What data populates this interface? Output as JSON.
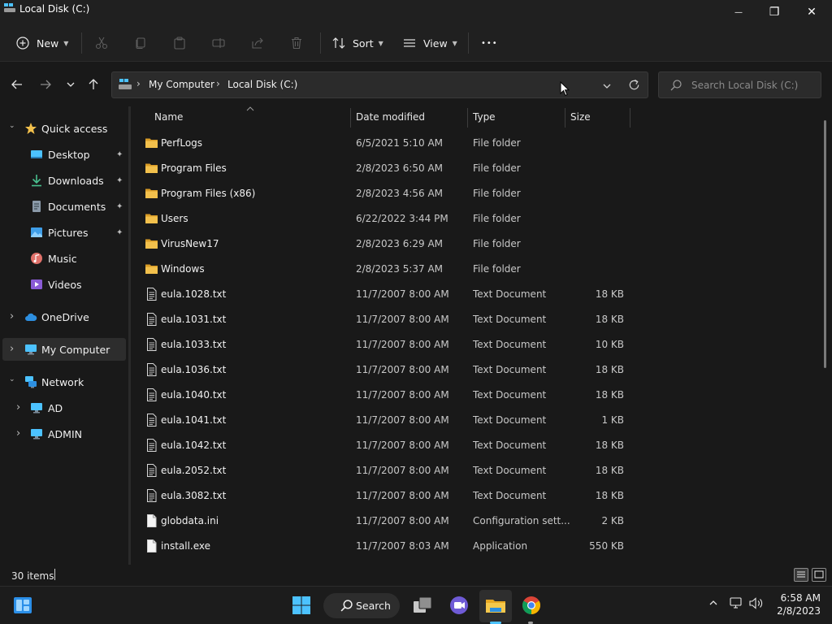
{
  "window": {
    "title": "Local Disk (C:)",
    "minimize_glyph": "—",
    "restore_glyph": "❐",
    "close_glyph": "✕"
  },
  "toolbar": {
    "new_label": "New",
    "sort_label": "Sort",
    "view_label": "View",
    "more_glyph": "•••"
  },
  "address": {
    "segments": [
      "My Computer",
      "Local Disk (C:)"
    ],
    "separator": "›",
    "search_placeholder": "Search Local Disk (C:)"
  },
  "sidebar": {
    "items": [
      {
        "label": "Quick access",
        "icon": "star-icon"
      },
      {
        "label": "Desktop",
        "icon": "desktop-icon"
      },
      {
        "label": "Downloads",
        "icon": "download-icon"
      },
      {
        "label": "Documents",
        "icon": "document-icon"
      },
      {
        "label": "Pictures",
        "icon": "picture-icon"
      },
      {
        "label": "Music",
        "icon": "music-icon"
      },
      {
        "label": "Videos",
        "icon": "video-icon"
      },
      {
        "label": "OneDrive",
        "icon": "cloud-icon"
      },
      {
        "label": "My Computer",
        "icon": "computer-icon"
      },
      {
        "label": "Network",
        "icon": "network-icon"
      },
      {
        "label": "AD",
        "icon": "computer-icon"
      },
      {
        "label": "ADMIN",
        "icon": "computer-icon"
      }
    ],
    "pin_glyph": "📌",
    "chevron_right": "›",
    "chevron_down": "⌄"
  },
  "columns": {
    "name": "Name",
    "date": "Date modified",
    "type": "Type",
    "size": "Size"
  },
  "files": [
    {
      "name": "PerfLogs",
      "date": "6/5/2021 5:10 AM",
      "type": "File folder",
      "size": "",
      "kind": "folder"
    },
    {
      "name": "Program Files",
      "date": "2/8/2023 6:50 AM",
      "type": "File folder",
      "size": "",
      "kind": "folder"
    },
    {
      "name": "Program Files (x86)",
      "date": "2/8/2023 4:56 AM",
      "type": "File folder",
      "size": "",
      "kind": "folder"
    },
    {
      "name": "Users",
      "date": "6/22/2022 3:44 PM",
      "type": "File folder",
      "size": "",
      "kind": "folder"
    },
    {
      "name": "VirusNew17",
      "date": "2/8/2023 6:29 AM",
      "type": "File folder",
      "size": "",
      "kind": "folder"
    },
    {
      "name": "Windows",
      "date": "2/8/2023 5:37 AM",
      "type": "File folder",
      "size": "",
      "kind": "folder"
    },
    {
      "name": "eula.1028.txt",
      "date": "11/7/2007 8:00 AM",
      "type": "Text Document",
      "size": "18 KB",
      "kind": "text"
    },
    {
      "name": "eula.1031.txt",
      "date": "11/7/2007 8:00 AM",
      "type": "Text Document",
      "size": "18 KB",
      "kind": "text"
    },
    {
      "name": "eula.1033.txt",
      "date": "11/7/2007 8:00 AM",
      "type": "Text Document",
      "size": "10 KB",
      "kind": "text"
    },
    {
      "name": "eula.1036.txt",
      "date": "11/7/2007 8:00 AM",
      "type": "Text Document",
      "size": "18 KB",
      "kind": "text"
    },
    {
      "name": "eula.1040.txt",
      "date": "11/7/2007 8:00 AM",
      "type": "Text Document",
      "size": "18 KB",
      "kind": "text"
    },
    {
      "name": "eula.1041.txt",
      "date": "11/7/2007 8:00 AM",
      "type": "Text Document",
      "size": "1 KB",
      "kind": "text"
    },
    {
      "name": "eula.1042.txt",
      "date": "11/7/2007 8:00 AM",
      "type": "Text Document",
      "size": "18 KB",
      "kind": "text"
    },
    {
      "name": "eula.2052.txt",
      "date": "11/7/2007 8:00 AM",
      "type": "Text Document",
      "size": "18 KB",
      "kind": "text"
    },
    {
      "name": "eula.3082.txt",
      "date": "11/7/2007 8:00 AM",
      "type": "Text Document",
      "size": "18 KB",
      "kind": "text"
    },
    {
      "name": "globdata.ini",
      "date": "11/7/2007 8:00 AM",
      "type": "Configuration sett...",
      "size": "2 KB",
      "kind": "file"
    },
    {
      "name": "install.exe",
      "date": "11/7/2007 8:03 AM",
      "type": "Application",
      "size": "550 KB",
      "kind": "file"
    }
  ],
  "status": {
    "item_count": "30 items"
  },
  "taskbar": {
    "search_label": "Search",
    "time": "6:58 AM",
    "date": "2/8/2023"
  },
  "colors": {
    "folder": "#f2c04c",
    "accent": "#4cc2ff",
    "background": "#191919"
  }
}
